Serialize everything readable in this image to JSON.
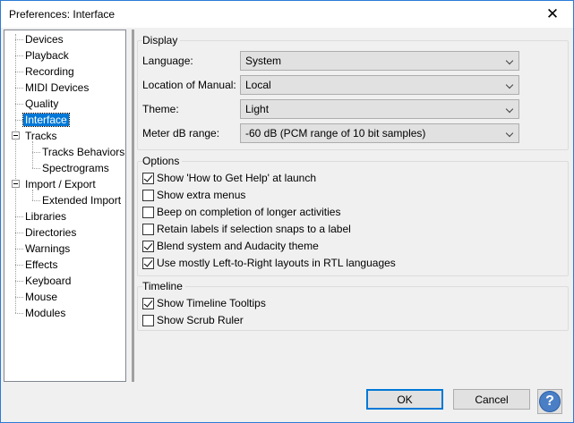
{
  "window": {
    "title": "Preferences: Interface",
    "close_glyph": "✕"
  },
  "tree": {
    "items": [
      {
        "label": "Devices"
      },
      {
        "label": "Playback"
      },
      {
        "label": "Recording"
      },
      {
        "label": "MIDI Devices"
      },
      {
        "label": "Quality"
      },
      {
        "label": "Interface",
        "selected": true
      },
      {
        "label": "Tracks",
        "expanded": true
      },
      {
        "label": "Tracks Behaviors"
      },
      {
        "label": "Spectrograms"
      },
      {
        "label": "Import / Export",
        "expanded": true
      },
      {
        "label": "Extended Import"
      },
      {
        "label": "Libraries"
      },
      {
        "label": "Directories"
      },
      {
        "label": "Warnings"
      },
      {
        "label": "Effects"
      },
      {
        "label": "Keyboard"
      },
      {
        "label": "Mouse"
      },
      {
        "label": "Modules"
      }
    ]
  },
  "display": {
    "title": "Display",
    "language": {
      "label": "Language:",
      "value": "System"
    },
    "manual": {
      "label": "Location of Manual:",
      "value": "Local"
    },
    "theme": {
      "label": "Theme:",
      "value": "Light"
    },
    "meter": {
      "label": "Meter dB range:",
      "value": "-60 dB (PCM range of 10 bit samples)"
    }
  },
  "options": {
    "title": "Options",
    "items": [
      {
        "label": "Show 'How to Get Help' at launch",
        "checked": true
      },
      {
        "label": "Show extra menus",
        "checked": false
      },
      {
        "label": "Beep on completion of longer activities",
        "checked": false
      },
      {
        "label": "Retain labels if selection snaps to a label",
        "checked": false
      },
      {
        "label": "Blend system and Audacity theme",
        "checked": true
      },
      {
        "label": "Use mostly Left-to-Right layouts in RTL languages",
        "checked": true
      }
    ]
  },
  "timeline": {
    "title": "Timeline",
    "items": [
      {
        "label": "Show Timeline Tooltips",
        "checked": true
      },
      {
        "label": "Show Scrub Ruler",
        "checked": false
      }
    ]
  },
  "buttons": {
    "ok": "OK",
    "cancel": "Cancel",
    "help": "?"
  },
  "colors": {
    "accent": "#0078d7",
    "help": "#4a7fc6"
  }
}
